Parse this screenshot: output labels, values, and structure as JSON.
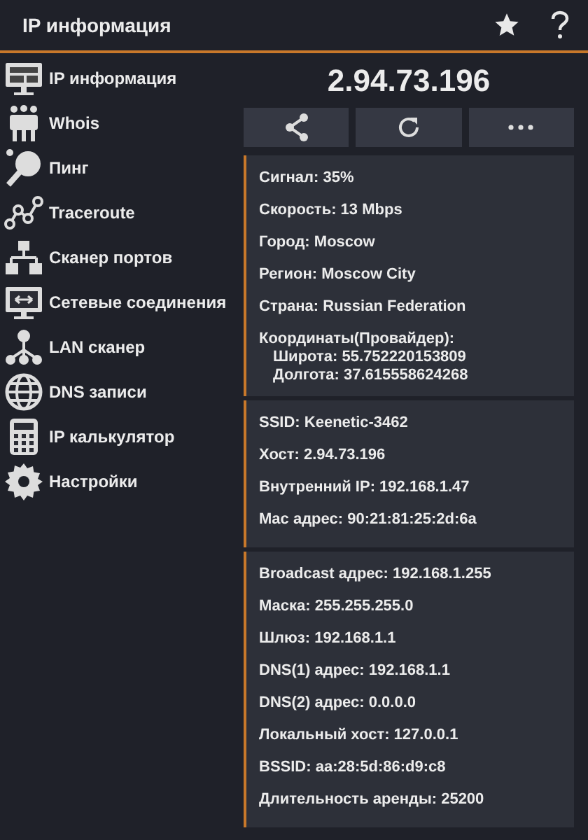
{
  "header": {
    "title": "IP информация"
  },
  "sidebar": {
    "items": [
      {
        "label": "IP информация"
      },
      {
        "label": "Whois"
      },
      {
        "label": "Пинг"
      },
      {
        "label": "Traceroute"
      },
      {
        "label": "Сканер портов"
      },
      {
        "label": "Сетевые соединения"
      },
      {
        "label": "LAN сканер"
      },
      {
        "label": "DNS записи"
      },
      {
        "label": "IP калькулятор"
      },
      {
        "label": "Настройки"
      }
    ]
  },
  "ip": "2.94.73.196",
  "cards": [
    {
      "rows": [
        {
          "kind": "line",
          "text": "Сигнал: 35%"
        },
        {
          "kind": "line",
          "text": "Скорость: 13 Mbps"
        },
        {
          "kind": "line",
          "text": "Город: Moscow"
        },
        {
          "kind": "line",
          "text": "Регион: Moscow City"
        },
        {
          "kind": "line",
          "text": "Страна: Russian Federation"
        },
        {
          "kind": "coords",
          "text": "Координаты(Провайдер):",
          "lines": [
            "Широта: 55.752220153809",
            "Долгота: 37.615558624268"
          ]
        }
      ]
    },
    {
      "rows": [
        {
          "kind": "line",
          "text": "SSID: Keenetic-3462"
        },
        {
          "kind": "line",
          "text": "Хост: 2.94.73.196"
        },
        {
          "kind": "line",
          "text": "Внутренний IP: 192.168.1.47"
        },
        {
          "kind": "line",
          "text": "Mac адрес: 90:21:81:25:2d:6a"
        }
      ]
    },
    {
      "rows": [
        {
          "kind": "line",
          "text": "Broadcast адрес: 192.168.1.255"
        },
        {
          "kind": "line",
          "text": "Маска: 255.255.255.0"
        },
        {
          "kind": "line",
          "text": "Шлюз: 192.168.1.1"
        },
        {
          "kind": "line",
          "text": "DNS(1) адрес: 192.168.1.1"
        },
        {
          "kind": "line",
          "text": "DNS(2) адрес: 0.0.0.0"
        },
        {
          "kind": "line",
          "text": "Локальный хост: 127.0.0.1"
        },
        {
          "kind": "line",
          "text": "BSSID: aa:28:5d:86:d9:c8"
        },
        {
          "kind": "line",
          "text": "Длительность аренды: 25200"
        }
      ]
    }
  ]
}
